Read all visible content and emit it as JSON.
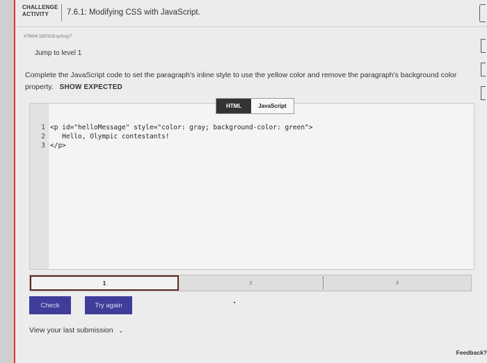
{
  "header": {
    "badge_line1": "CHALLENGE",
    "badge_line2": "ACTIVITY",
    "title": "7.6.1: Modifying CSS with JavaScript."
  },
  "activity_code": "479894.3387628.qx3zqy7",
  "jump_link": "Jump to level 1",
  "instructions": {
    "text": "Complete the JavaScript code to set the paragraph's inline style to use the yellow color and remove the paragraph's background color property.",
    "show_expected": "SHOW EXPECTED"
  },
  "tabs": [
    {
      "label": "HTML",
      "active": true
    },
    {
      "label": "JavaScript",
      "active": false
    }
  ],
  "editor": {
    "lines": [
      {
        "num": "1",
        "code": "<p id=\"helloMessage\" style=\"color: gray; background-color: green\">"
      },
      {
        "num": "2",
        "code": "   Hello, Olympic contestants!"
      },
      {
        "num": "3",
        "code": "</p>"
      }
    ]
  },
  "levels": [
    {
      "label": "1",
      "active": true
    },
    {
      "label": "2",
      "active": false
    },
    {
      "label": "3",
      "active": false
    }
  ],
  "buttons": {
    "check": "Check",
    "try_again": "Try again"
  },
  "view_last_submission": "View your last submission",
  "feedback": "Feedback?",
  "colors": {
    "accent": "#d33333",
    "button_bg": "#3f3d9a",
    "active_tab_bg": "#333333"
  }
}
